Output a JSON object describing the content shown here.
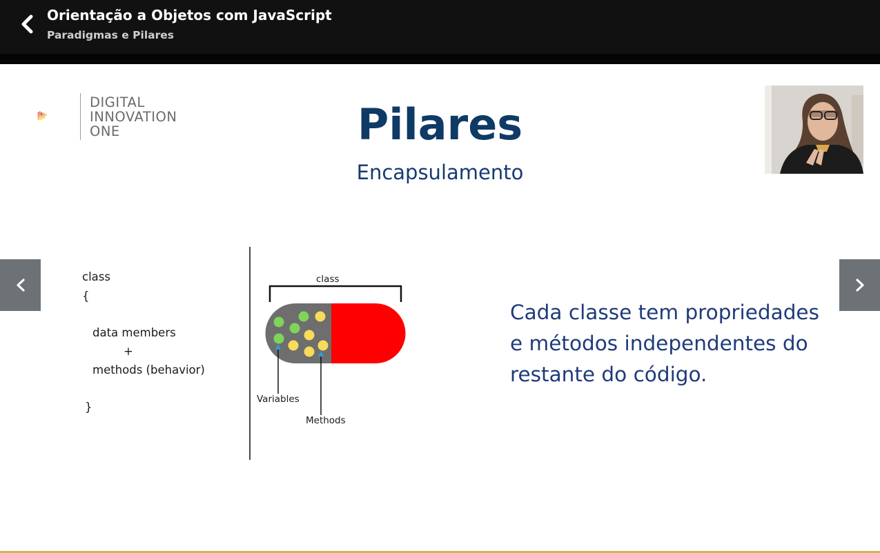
{
  "header": {
    "course_title": "Orientação a Objetos com JavaScript",
    "lesson_title": "Paradigmas e Pilares",
    "back_icon": "chevron-left-icon"
  },
  "slide": {
    "logo": {
      "line1": "DIGITAL",
      "line2": "INNOVATION",
      "line3": "ONE"
    },
    "title": "Pilares",
    "subtitle": "Encapsulamento",
    "code": {
      "line1": "class",
      "line2": "{",
      "line3": "data members",
      "line4": "+",
      "line5": "methods (behavior)",
      "line6": "}"
    },
    "diagram": {
      "class_label": "class",
      "variables_label": "Variables",
      "methods_label": "Methods"
    },
    "body_text": "Cada classe tem propriedades e métodos independentes do restante do código."
  },
  "navigation": {
    "prev_icon": "chevron-left-icon",
    "next_icon": "chevron-right-icon"
  },
  "colors": {
    "topbar": "#111111",
    "title": "#0f3a66",
    "body_text": "#1f3b7a",
    "capsule_red": "#ff0000",
    "capsule_gray": "#6e6e6e",
    "dot_green": "#7fd45a",
    "dot_yellow": "#f7dc5a",
    "nav_button": "#6d7276",
    "bottom_line": "#d6b35a"
  }
}
